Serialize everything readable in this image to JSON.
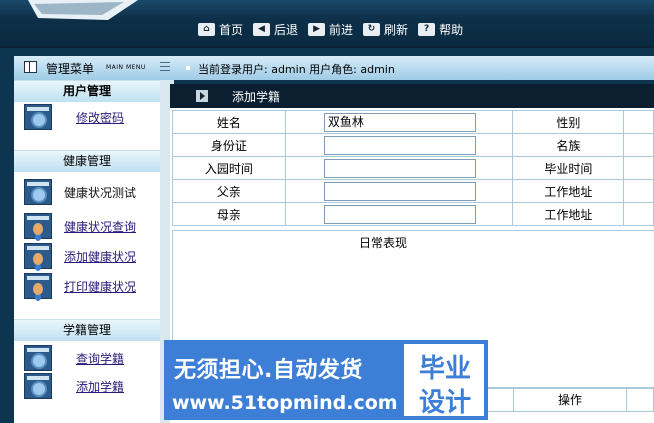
{
  "toolbar": {
    "home": "首页",
    "back": "后退",
    "forward": "前进",
    "refresh": "刷新",
    "help": "帮助"
  },
  "sidebar": {
    "header_title": "管理菜单",
    "header_sub": "MAIN MENU",
    "groups": [
      {
        "title": "用户管理",
        "items": [
          {
            "label": "修改密码"
          }
        ]
      },
      {
        "title": "健康管理",
        "items": [
          {
            "label": "健康状况测试"
          },
          {
            "label": "健康状况查询"
          },
          {
            "label": "添加健康状况"
          },
          {
            "label": "打印健康状况"
          }
        ]
      },
      {
        "title": "学籍管理",
        "items": [
          {
            "label": "查询学籍"
          },
          {
            "label": "添加学籍"
          }
        ]
      }
    ]
  },
  "userbar": {
    "text": "当前登录用户: admin  用户角色: admin"
  },
  "form": {
    "title": "添加学籍",
    "rows": [
      {
        "label": "姓名",
        "value": "双鱼林",
        "label2": "性别"
      },
      {
        "label": "身份证",
        "value": "",
        "label2": "名族"
      },
      {
        "label": "入园时间",
        "value": "",
        "label2": "毕业时间"
      },
      {
        "label": "父亲",
        "value": "",
        "label2": "工作地址"
      },
      {
        "label": "母亲",
        "value": "",
        "label2": "工作地址"
      }
    ],
    "remark_label": "日常表现",
    "operation_label": "操作"
  },
  "banner": {
    "line1": "无须担心.自动发货",
    "line2": "www.51topmind.com",
    "box_line1": "毕业",
    "box_line2": "设计"
  }
}
